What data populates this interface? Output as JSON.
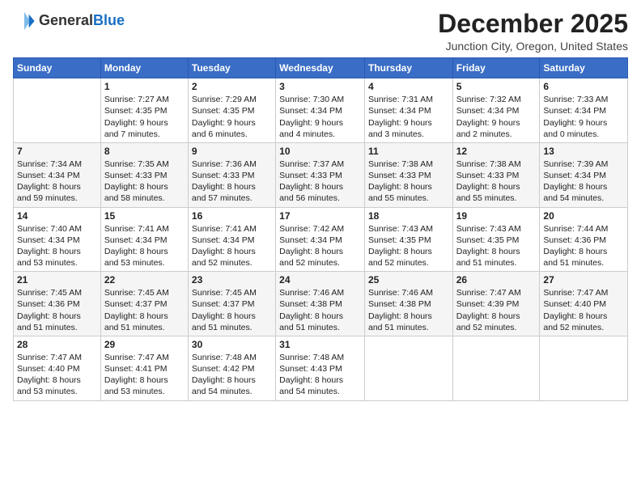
{
  "header": {
    "logo_general": "General",
    "logo_blue": "Blue",
    "month_title": "December 2025",
    "location": "Junction City, Oregon, United States"
  },
  "days_of_week": [
    "Sunday",
    "Monday",
    "Tuesday",
    "Wednesday",
    "Thursday",
    "Friday",
    "Saturday"
  ],
  "weeks": [
    [
      {
        "day": "",
        "text": ""
      },
      {
        "day": "1",
        "text": "Sunrise: 7:27 AM\nSunset: 4:35 PM\nDaylight: 9 hours\nand 7 minutes."
      },
      {
        "day": "2",
        "text": "Sunrise: 7:29 AM\nSunset: 4:35 PM\nDaylight: 9 hours\nand 6 minutes."
      },
      {
        "day": "3",
        "text": "Sunrise: 7:30 AM\nSunset: 4:34 PM\nDaylight: 9 hours\nand 4 minutes."
      },
      {
        "day": "4",
        "text": "Sunrise: 7:31 AM\nSunset: 4:34 PM\nDaylight: 9 hours\nand 3 minutes."
      },
      {
        "day": "5",
        "text": "Sunrise: 7:32 AM\nSunset: 4:34 PM\nDaylight: 9 hours\nand 2 minutes."
      },
      {
        "day": "6",
        "text": "Sunrise: 7:33 AM\nSunset: 4:34 PM\nDaylight: 9 hours\nand 0 minutes."
      }
    ],
    [
      {
        "day": "7",
        "text": "Sunrise: 7:34 AM\nSunset: 4:34 PM\nDaylight: 8 hours\nand 59 minutes."
      },
      {
        "day": "8",
        "text": "Sunrise: 7:35 AM\nSunset: 4:33 PM\nDaylight: 8 hours\nand 58 minutes."
      },
      {
        "day": "9",
        "text": "Sunrise: 7:36 AM\nSunset: 4:33 PM\nDaylight: 8 hours\nand 57 minutes."
      },
      {
        "day": "10",
        "text": "Sunrise: 7:37 AM\nSunset: 4:33 PM\nDaylight: 8 hours\nand 56 minutes."
      },
      {
        "day": "11",
        "text": "Sunrise: 7:38 AM\nSunset: 4:33 PM\nDaylight: 8 hours\nand 55 minutes."
      },
      {
        "day": "12",
        "text": "Sunrise: 7:38 AM\nSunset: 4:33 PM\nDaylight: 8 hours\nand 55 minutes."
      },
      {
        "day": "13",
        "text": "Sunrise: 7:39 AM\nSunset: 4:34 PM\nDaylight: 8 hours\nand 54 minutes."
      }
    ],
    [
      {
        "day": "14",
        "text": "Sunrise: 7:40 AM\nSunset: 4:34 PM\nDaylight: 8 hours\nand 53 minutes."
      },
      {
        "day": "15",
        "text": "Sunrise: 7:41 AM\nSunset: 4:34 PM\nDaylight: 8 hours\nand 53 minutes."
      },
      {
        "day": "16",
        "text": "Sunrise: 7:41 AM\nSunset: 4:34 PM\nDaylight: 8 hours\nand 52 minutes."
      },
      {
        "day": "17",
        "text": "Sunrise: 7:42 AM\nSunset: 4:34 PM\nDaylight: 8 hours\nand 52 minutes."
      },
      {
        "day": "18",
        "text": "Sunrise: 7:43 AM\nSunset: 4:35 PM\nDaylight: 8 hours\nand 52 minutes."
      },
      {
        "day": "19",
        "text": "Sunrise: 7:43 AM\nSunset: 4:35 PM\nDaylight: 8 hours\nand 51 minutes."
      },
      {
        "day": "20",
        "text": "Sunrise: 7:44 AM\nSunset: 4:36 PM\nDaylight: 8 hours\nand 51 minutes."
      }
    ],
    [
      {
        "day": "21",
        "text": "Sunrise: 7:45 AM\nSunset: 4:36 PM\nDaylight: 8 hours\nand 51 minutes."
      },
      {
        "day": "22",
        "text": "Sunrise: 7:45 AM\nSunset: 4:37 PM\nDaylight: 8 hours\nand 51 minutes."
      },
      {
        "day": "23",
        "text": "Sunrise: 7:45 AM\nSunset: 4:37 PM\nDaylight: 8 hours\nand 51 minutes."
      },
      {
        "day": "24",
        "text": "Sunrise: 7:46 AM\nSunset: 4:38 PM\nDaylight: 8 hours\nand 51 minutes."
      },
      {
        "day": "25",
        "text": "Sunrise: 7:46 AM\nSunset: 4:38 PM\nDaylight: 8 hours\nand 51 minutes."
      },
      {
        "day": "26",
        "text": "Sunrise: 7:47 AM\nSunset: 4:39 PM\nDaylight: 8 hours\nand 52 minutes."
      },
      {
        "day": "27",
        "text": "Sunrise: 7:47 AM\nSunset: 4:40 PM\nDaylight: 8 hours\nand 52 minutes."
      }
    ],
    [
      {
        "day": "28",
        "text": "Sunrise: 7:47 AM\nSunset: 4:40 PM\nDaylight: 8 hours\nand 53 minutes."
      },
      {
        "day": "29",
        "text": "Sunrise: 7:47 AM\nSunset: 4:41 PM\nDaylight: 8 hours\nand 53 minutes."
      },
      {
        "day": "30",
        "text": "Sunrise: 7:48 AM\nSunset: 4:42 PM\nDaylight: 8 hours\nand 54 minutes."
      },
      {
        "day": "31",
        "text": "Sunrise: 7:48 AM\nSunset: 4:43 PM\nDaylight: 8 hours\nand 54 minutes."
      },
      {
        "day": "",
        "text": ""
      },
      {
        "day": "",
        "text": ""
      },
      {
        "day": "",
        "text": ""
      }
    ]
  ]
}
